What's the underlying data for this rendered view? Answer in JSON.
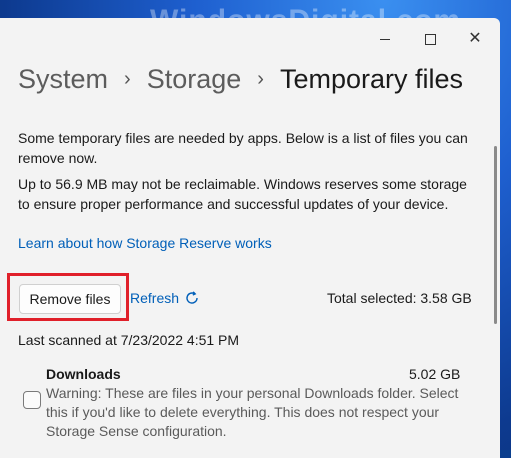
{
  "watermark": "WindowsDigital.com",
  "breadcrumb": {
    "items": [
      "System",
      "Storage"
    ],
    "current": "Temporary files"
  },
  "content": {
    "paragraph1": "Some temporary files are needed by apps. Below is a list of files you can remove now.",
    "paragraph2": "Up to 56.9 MB may not be reclaimable. Windows reserves some storage to ensure proper performance and successful updates of your device.",
    "link": "Learn about how Storage Reserve works"
  },
  "actions": {
    "remove_label": "Remove files",
    "refresh_label": "Refresh",
    "total_selected": "Total selected: 3.58 GB"
  },
  "last_scanned": "Last scanned at 7/23/2022 4:51 PM",
  "items": [
    {
      "title": "Downloads",
      "size": "5.02 GB",
      "description": "Warning: These are files in your personal Downloads folder. Select this if you'd like to delete everything. This does not respect your Storage Sense configuration.",
      "checked": false
    }
  ],
  "colors": {
    "accent": "#005fb8",
    "highlight": "#e0202a",
    "background": "#f3f3f3"
  }
}
